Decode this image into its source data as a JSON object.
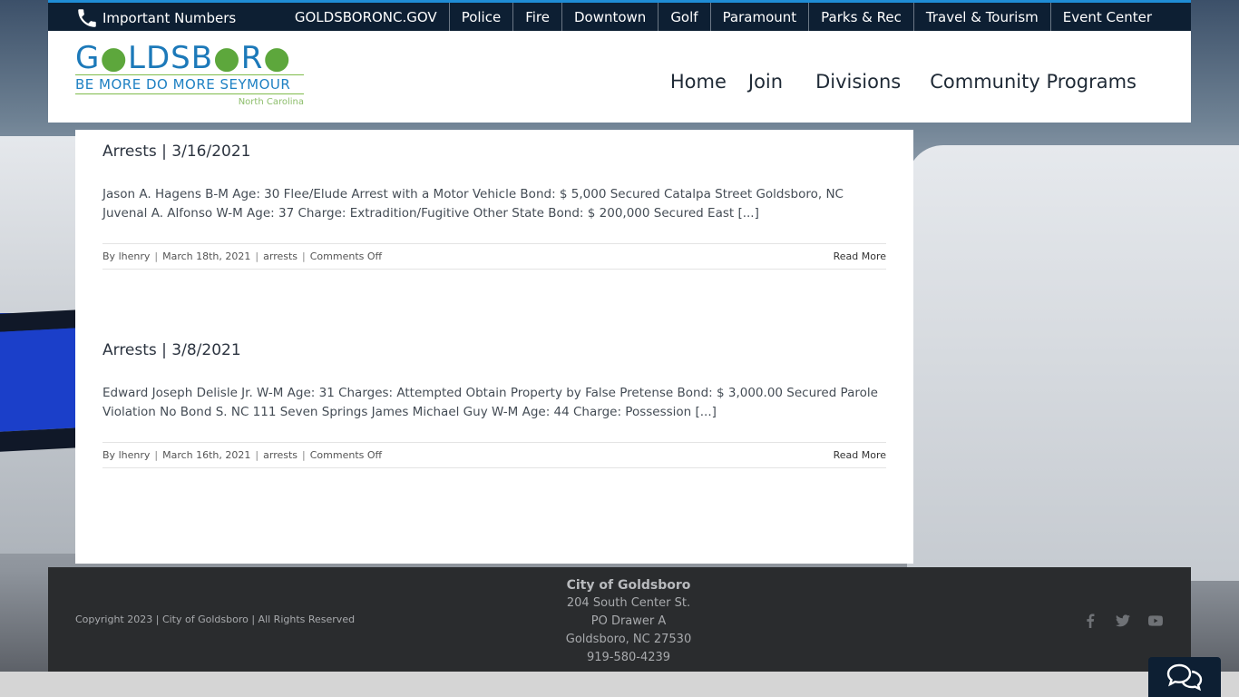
{
  "topbar": {
    "important": "Important Numbers",
    "links": [
      "GOLDSBORONC.GOV",
      "Police",
      "Fire",
      "Downtown",
      "Golf",
      "Paramount",
      "Parks & Rec",
      "Travel & Tourism",
      "Event Center"
    ]
  },
  "logo": {
    "word_a": "G",
    "word_b": "LDSB",
    "word_c": "R",
    "tagline": "BE MORE  DO MORE  SEYMOUR",
    "state": "North Carolina"
  },
  "nav": [
    "Home",
    "Join",
    "Divisions",
    "Community Programs"
  ],
  "posts": [
    {
      "title": "Arrests | 3/16/2021",
      "excerpt": "Jason A. Hagens B-M Age: 30 Flee/Elude Arrest with a Motor Vehicle Bond: $ 5,000 Secured Catalpa Street Goldsboro, NC Juvenal A. Alfonso W-M Age: 37 Charge: Extradition/Fugitive Other State Bond: $ 200,000 Secured East [...]",
      "by": "By",
      "author": "lhenry",
      "date": "March 18th, 2021",
      "category": "arrests",
      "comments": "Comments Off",
      "read_more": "Read More"
    },
    {
      "title": "Arrests | 3/8/2021",
      "excerpt": "Edward Joseph Delisle Jr. W-M Age: 31 Charges: Attempted Obtain Property by False Pretense Bond: $ 3,000.00 Secured Parole Violation No Bond S. NC 111 Seven Springs James Michael Guy W-M Age: 44 Charge: Possession [...]",
      "by": "By",
      "author": "lhenry",
      "date": "March 16th, 2021",
      "category": "arrests",
      "comments": "Comments Off",
      "read_more": "Read More"
    }
  ],
  "footer": {
    "copyright": "Copyright 2023 | City of Goldsboro | All Rights Reserved",
    "city": "City of Goldsboro",
    "address1": "204 South Center St.",
    "address2": "PO Drawer A",
    "address3": "Goldsboro, NC 27530",
    "phone": "919-580-4239",
    "social": [
      "facebook-icon",
      "twitter-icon",
      "youtube-icon"
    ]
  },
  "colors": {
    "topbar": "#0d1f33",
    "accent": "#1f8dd6",
    "logo_blue": "#1c79b9",
    "logo_green": "#5da73c",
    "footer": "#2a2c2e"
  }
}
